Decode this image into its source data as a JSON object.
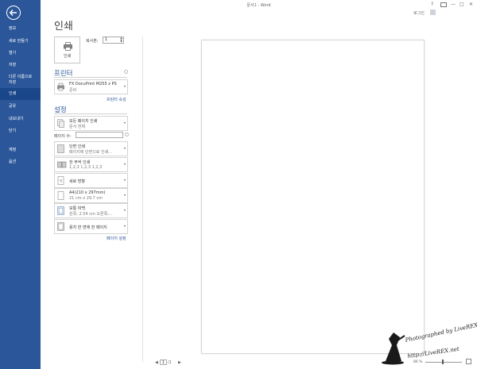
{
  "window": {
    "title": "문서1 - Word",
    "help": "?",
    "minimize": "—",
    "restore": "□",
    "close": "✕",
    "login": "로그인"
  },
  "sidebar": {
    "items": [
      {
        "label": "정보"
      },
      {
        "label": "새로 만들기"
      },
      {
        "label": "열기"
      },
      {
        "label": "저장"
      },
      {
        "label": "다른 이름으로",
        "label2": "저장"
      },
      {
        "label": "인쇄"
      },
      {
        "label": "공유"
      },
      {
        "label": "내보내기"
      },
      {
        "label": "닫기"
      },
      {
        "label": "계정"
      },
      {
        "label": "옵션"
      }
    ]
  },
  "print": {
    "title": "인쇄",
    "button_label": "인쇄",
    "copies_label": "복사본:",
    "copies_value": "1"
  },
  "printer": {
    "section_title": "프린터",
    "name": "FX DocuPrint M255 z PS",
    "status": "준비",
    "properties_link": "프린터 속성"
  },
  "settings": {
    "section_title": "설정",
    "range": {
      "l1": "모든 페이지 인쇄",
      "l2": "문서 전체"
    },
    "pages_label": "페이지 수:",
    "sides": {
      "l1": "단면 인쇄",
      "l2": "페이지에 단면으로 인쇄..."
    },
    "collate": {
      "l1": "한 부씩 인쇄",
      "l2": "1,2,3    1,2,3    1,2,3"
    },
    "orientation": {
      "l1": "세로 방향"
    },
    "paper": {
      "l1": "A4(210 x 297mm)",
      "l2": "21 cm x 29.7 cm"
    },
    "margins": {
      "l1": "보통 여백",
      "l2": "왼쪽:  2.54 cm    오른쪽:..."
    },
    "per_sheet": {
      "l1": "용지 한 면에 한 페이지"
    },
    "page_setup_link": "페이지 설정"
  },
  "preview": {
    "prev": "◀",
    "page": "1",
    "of": "/1",
    "next": "▶",
    "zoom": "86 %"
  },
  "watermark": {
    "line1": "Photographed by LiveREX",
    "line2": "http://LiveREX.net"
  }
}
